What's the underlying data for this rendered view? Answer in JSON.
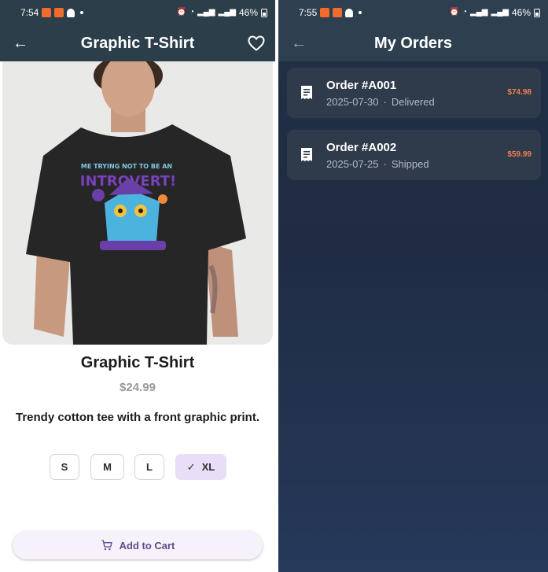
{
  "product_screen": {
    "status_bar": {
      "time": "7:54",
      "battery": "46%"
    },
    "app_bar": {
      "title": "Graphic T-Shirt"
    },
    "product": {
      "name": "Graphic T-Shirt",
      "price": "$24.99",
      "description": "Trendy cotton tee with a front graphic print.",
      "shirt_print_text": "ME TRYING NOT TO BE AN INTROVERT!"
    },
    "sizes": [
      {
        "label": "S",
        "selected": false
      },
      {
        "label": "M",
        "selected": false
      },
      {
        "label": "L",
        "selected": false
      },
      {
        "label": "XL",
        "selected": true
      }
    ],
    "add_to_cart_label": "Add to Cart"
  },
  "orders_screen": {
    "status_bar": {
      "time": "7:55",
      "battery": "46%"
    },
    "app_bar": {
      "title": "My Orders"
    },
    "orders": [
      {
        "id": "Order #A001",
        "date": "2025-07-30",
        "status": "Delivered",
        "total": "$74.98"
      },
      {
        "id": "Order #A002",
        "date": "2025-07-25",
        "status": "Shipped",
        "total": "$59.99"
      }
    ]
  },
  "colors": {
    "app_bar": "#2c3e4a",
    "order_total": "#f08152",
    "chip_selected": "#e8def8",
    "cart_text": "#5e4b8b",
    "orders_bg": "#1f2c44"
  }
}
